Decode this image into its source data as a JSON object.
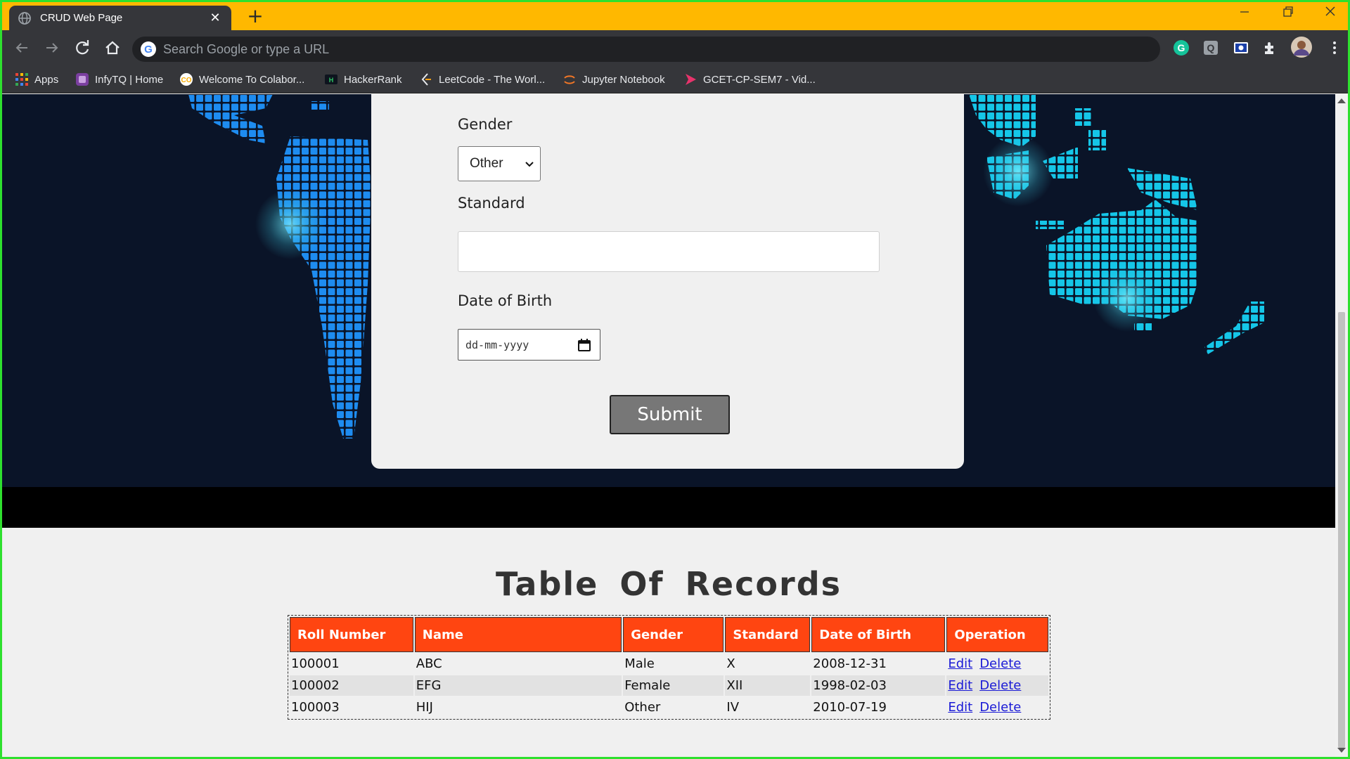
{
  "browser": {
    "tab_title": "CRUD Web Page",
    "tab_close": "✕",
    "new_tab": "+",
    "address_placeholder": "Search Google or type a URL",
    "google_badge": "G",
    "titlebar_color": "#ffb800",
    "bookmarks": [
      {
        "label": "Apps",
        "icon": "apps-grid-icon"
      },
      {
        "label": "InfyTQ | Home",
        "icon": "infytq-icon"
      },
      {
        "label": "Welcome To Colabor...",
        "icon": "colab-icon"
      },
      {
        "label": "HackerRank",
        "icon": "hackerrank-icon"
      },
      {
        "label": "LeetCode - The Worl...",
        "icon": "leetcode-icon"
      },
      {
        "label": "Jupyter Notebook",
        "icon": "jupyter-icon"
      },
      {
        "label": "GCET-CP-SEM7 - Vid...",
        "icon": "video-icon"
      }
    ],
    "extensions": [
      "grammarly-icon",
      "q-extension-icon",
      "screen-capture-icon",
      "puzzle-extensions-icon",
      "profile-avatar"
    ]
  },
  "form": {
    "gender_label": "Gender",
    "gender_value": "Other",
    "standard_label": "Standard",
    "standard_value": "",
    "dob_label": "Date of Birth",
    "dob_placeholder": "dd-mm-yyyy",
    "submit_label": "Submit"
  },
  "records": {
    "title": "Table Of Records",
    "header_color": "#ff4511",
    "columns": [
      "Roll Number",
      "Name",
      "Gender",
      "Standard",
      "Date of Birth",
      "Operation"
    ],
    "rows": [
      {
        "roll": "100001",
        "name": "ABC",
        "gender": "Male",
        "standard": "X",
        "dob": "2008-12-31",
        "edit": "Edit",
        "delete": "Delete"
      },
      {
        "roll": "100002",
        "name": "EFG",
        "gender": "Female",
        "standard": "XII",
        "dob": "1998-02-03",
        "edit": "Edit",
        "delete": "Delete"
      },
      {
        "roll": "100003",
        "name": "HIJ",
        "gender": "Other",
        "standard": "IV",
        "dob": "2010-07-19",
        "edit": "Edit",
        "delete": "Delete"
      }
    ]
  }
}
